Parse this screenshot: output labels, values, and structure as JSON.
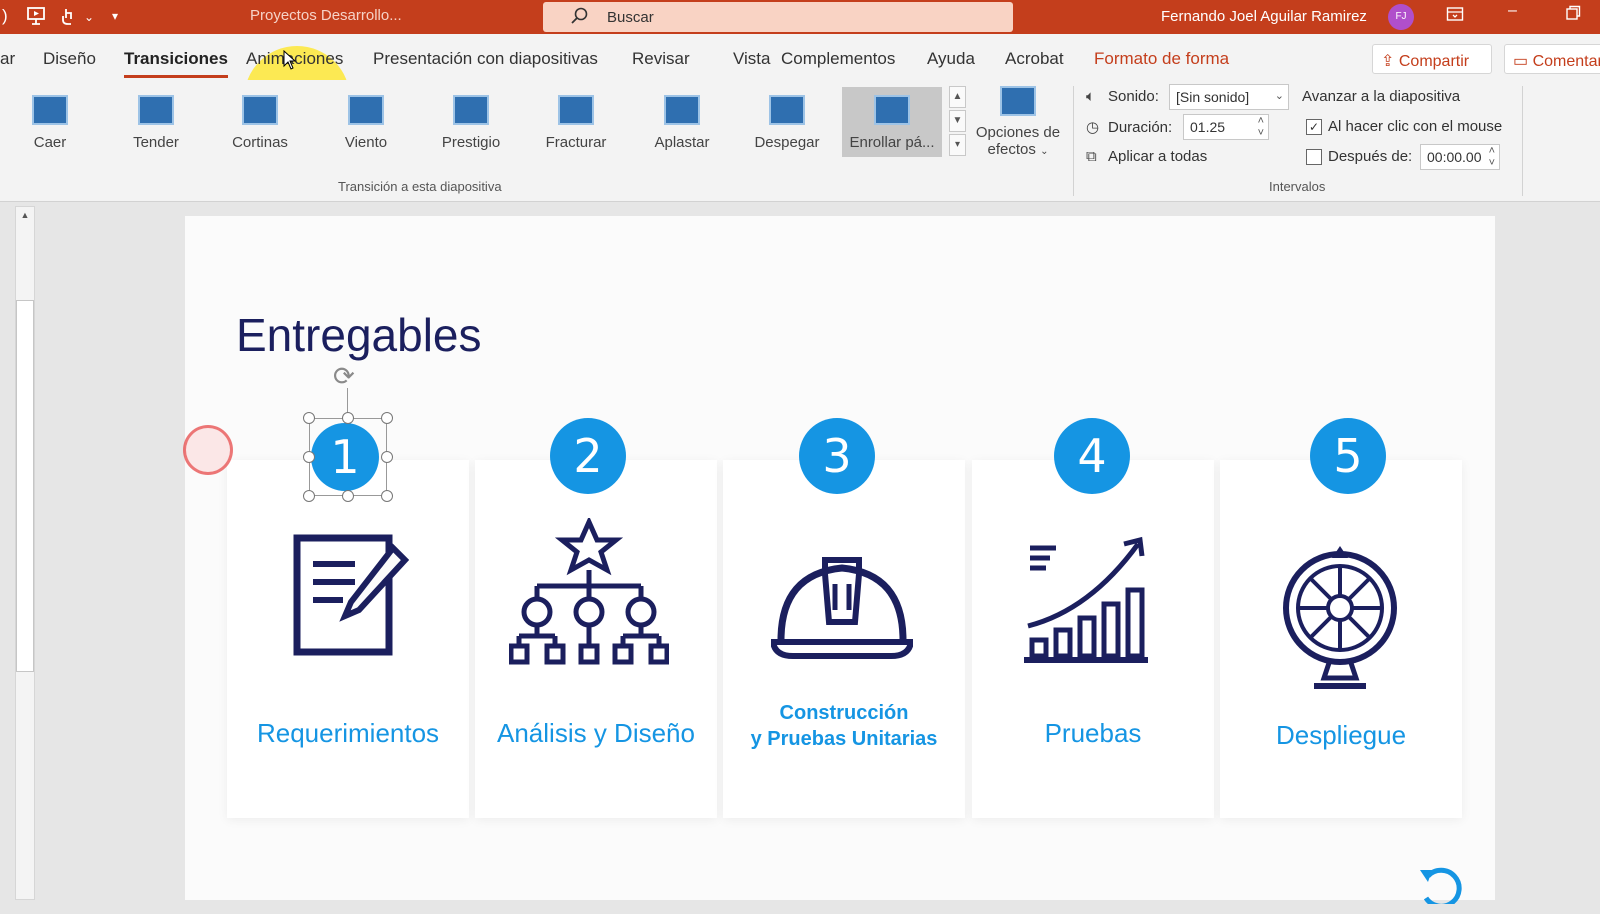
{
  "title_bar": {
    "document_title": "Proyectos Desarrollo...",
    "search_placeholder": "Buscar",
    "user_name": "Fernando Joel Aguilar Ramirez",
    "user_initials": "FJ",
    "accent_color": "#c43e1c"
  },
  "tabs": [
    {
      "label": "ar"
    },
    {
      "label": "Diseño"
    },
    {
      "label": "Transiciones",
      "active": true
    },
    {
      "label": "Animaciones"
    },
    {
      "label": "Presentación con diapositivas"
    },
    {
      "label": "Revisar"
    },
    {
      "label": "Vista"
    },
    {
      "label": "Complementos"
    },
    {
      "label": "Ayuda"
    },
    {
      "label": "Acrobat"
    },
    {
      "label": "Formato de forma"
    }
  ],
  "share_button": "Compartir",
  "comments_button": "Comentarios",
  "ribbon": {
    "gallery": [
      "Caer",
      "Tender",
      "Cortinas",
      "Viento",
      "Prestigio",
      "Fracturar",
      "Aplastar",
      "Despegar",
      "Enrollar pá..."
    ],
    "selected_transition": "Enrollar pá...",
    "effects_button_line1": "Opciones de",
    "effects_button_line2": "efectos",
    "group_transition_label": "Transición a esta diapositiva",
    "timing": {
      "sound_label": "Sonido:",
      "sound_value": "[Sin sonido]",
      "duration_label": "Duración:",
      "duration_value": "01.25",
      "apply_all_label": "Aplicar a todas",
      "advance_label": "Avanzar a la diapositiva",
      "on_click_label": "Al hacer clic con el mouse",
      "on_click_checked": true,
      "after_label": "Después de:",
      "after_value": "00:00.00",
      "after_checked": false,
      "group_label": "Intervalos"
    }
  },
  "slide": {
    "title": "Entregables",
    "accent_color": "#1595e3",
    "dark_color": "#1b1f5e",
    "cards": [
      {
        "number": "1",
        "label": "Requerimientos",
        "icon": "document-pencil-icon"
      },
      {
        "number": "2",
        "label": "Análisis y Diseño",
        "icon": "hierarchy-star-icon"
      },
      {
        "number": "3",
        "label_line1": "Construcción",
        "label_line2": "y Pruebas Unitarias",
        "icon": "hard-hat-icon"
      },
      {
        "number": "4",
        "label": "Pruebas",
        "icon": "growth-chart-icon"
      },
      {
        "number": "5",
        "label": "Despliegue",
        "icon": "wheel-icon"
      }
    ]
  }
}
